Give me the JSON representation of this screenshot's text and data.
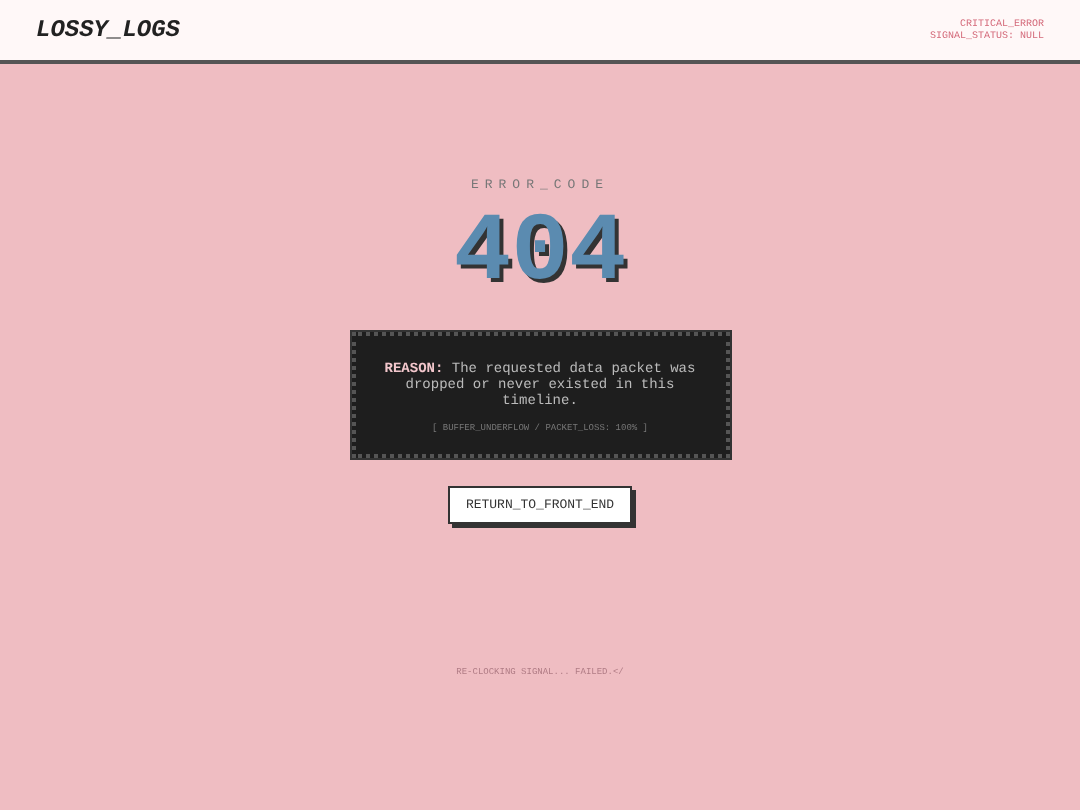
{
  "header": {
    "logo": "LOSSY_LOGS",
    "status_lines": [
      "CRITICAL_ERROR",
      "SIGNAL_STATUS: NULL"
    ]
  },
  "error": {
    "label": "ERROR_CODE",
    "code": "404"
  },
  "reason": {
    "text": "**REASON:** The requested data packet was dropped or never existed in this timeline.",
    "detail": "[ BUFFER_UNDERFLOW / PACKET_LOSS: 100% ]"
  },
  "button": {
    "label": "RETURN_TO_FRONT_END"
  },
  "footer": {
    "text": "RE-CLOCKING SIGNAL... FAILED.</"
  }
}
